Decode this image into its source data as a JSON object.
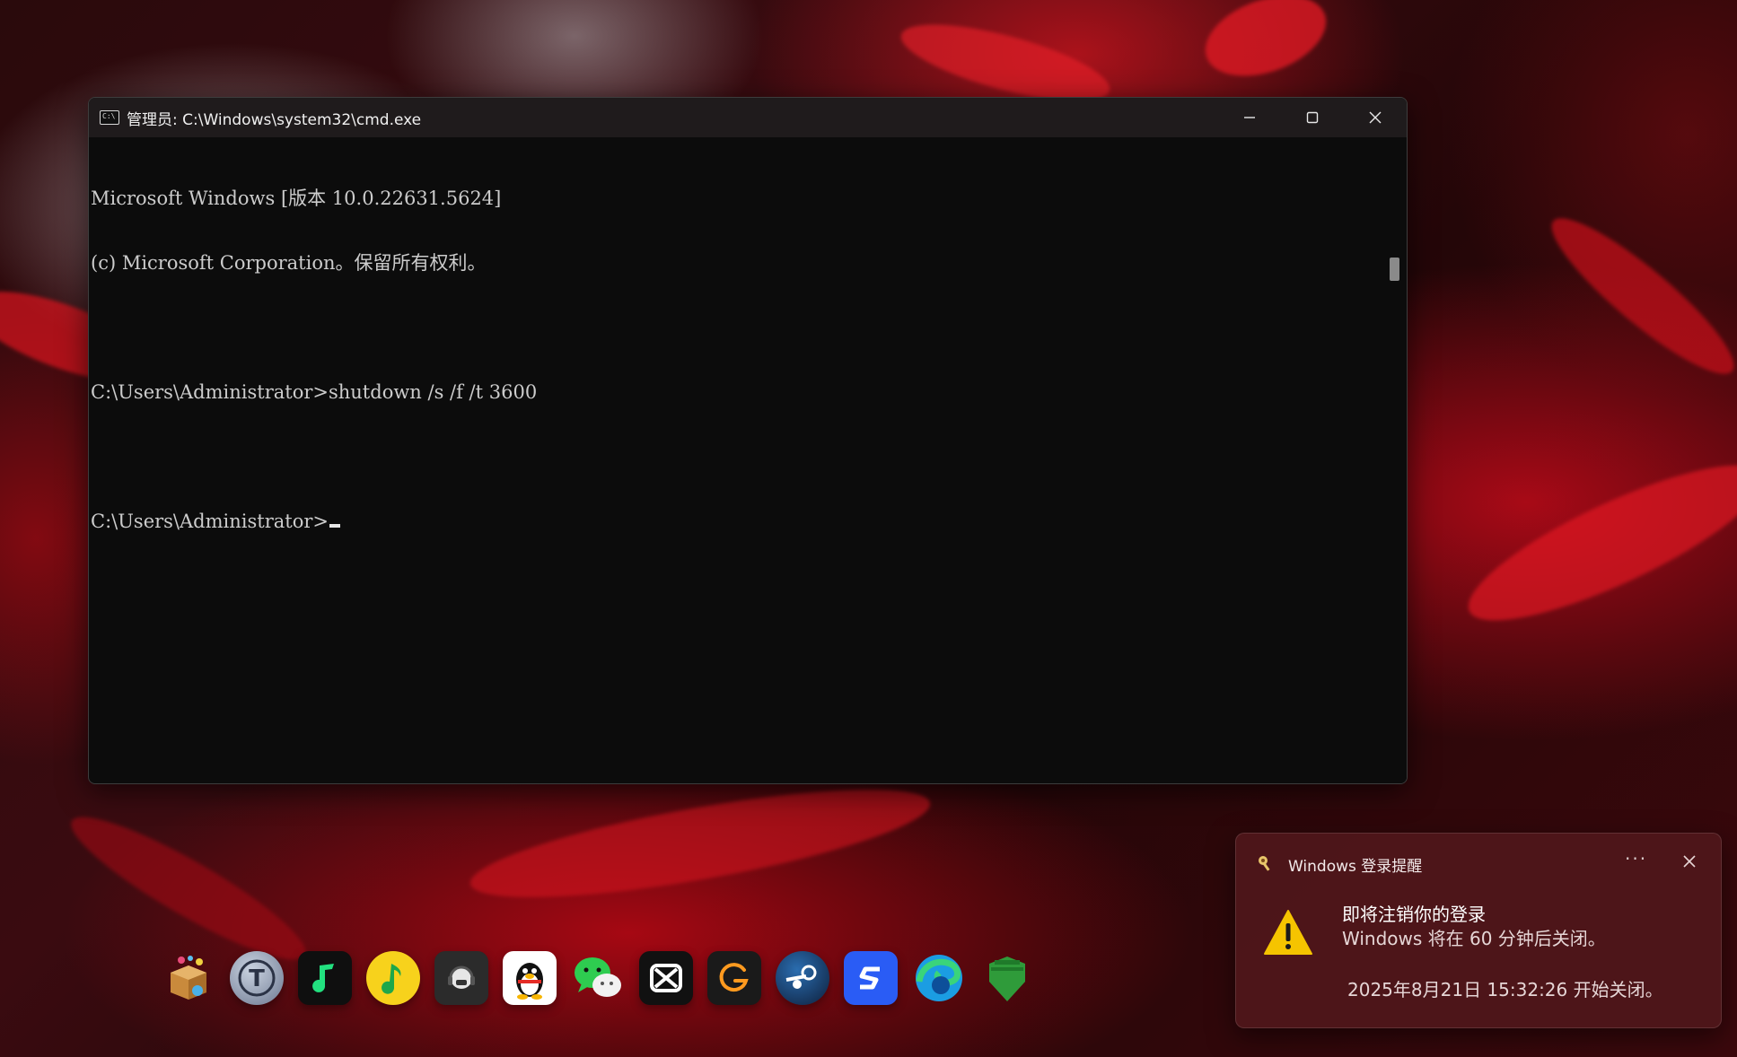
{
  "cmd": {
    "title": "管理员: C:\\Windows\\system32\\cmd.exe",
    "lines": [
      "Microsoft Windows [版本 10.0.22631.5624]",
      "(c) Microsoft Corporation。保留所有权利。",
      "",
      "C:\\Users\\Administrator>shutdown /s /f /t 3600",
      "",
      "C:\\Users\\Administrator>"
    ],
    "icons": {
      "minimize": "minimize-icon",
      "maximize": "maximize-icon",
      "close": "close-icon"
    }
  },
  "dock": {
    "apps": [
      {
        "name": "app-box",
        "icon": "package-icon",
        "color": "#d9a55a"
      },
      {
        "name": "app-t",
        "icon": "t-logo-icon",
        "color": "#8b97ad"
      },
      {
        "name": "app-music-green",
        "icon": "music-note-icon",
        "color": "#1fd07a"
      },
      {
        "name": "app-qq-music",
        "icon": "music-note-icon",
        "color": "#f7d21c"
      },
      {
        "name": "app-headset",
        "icon": "headset-icon",
        "color": "#2c2c2c"
      },
      {
        "name": "app-qq",
        "icon": "penguin-icon",
        "color": "#ffffff"
      },
      {
        "name": "app-wechat",
        "icon": "chat-bubble-icon",
        "color": "#2ecc50"
      },
      {
        "name": "app-capcut",
        "icon": "capcut-icon",
        "color": "#111111"
      },
      {
        "name": "app-g",
        "icon": "g-logo-icon",
        "color": "#1a1a1a"
      },
      {
        "name": "app-steam",
        "icon": "steam-icon",
        "color": "#1b3a63"
      },
      {
        "name": "app-s-blue",
        "icon": "s-logo-icon",
        "color": "#2a5cf5"
      },
      {
        "name": "app-edge",
        "icon": "edge-icon",
        "color": "#1b9de2"
      },
      {
        "name": "app-shield",
        "icon": "shield-icon",
        "color": "#2f9b3a"
      }
    ]
  },
  "toast": {
    "app_name": "Windows 登录提醒",
    "more": "···",
    "title": "即将注销你的登录",
    "body": "Windows 将在 60 分钟后关闭。",
    "footer": "2025年8月21日 15:32:26 开始关闭。",
    "accent": "#f5c400"
  }
}
